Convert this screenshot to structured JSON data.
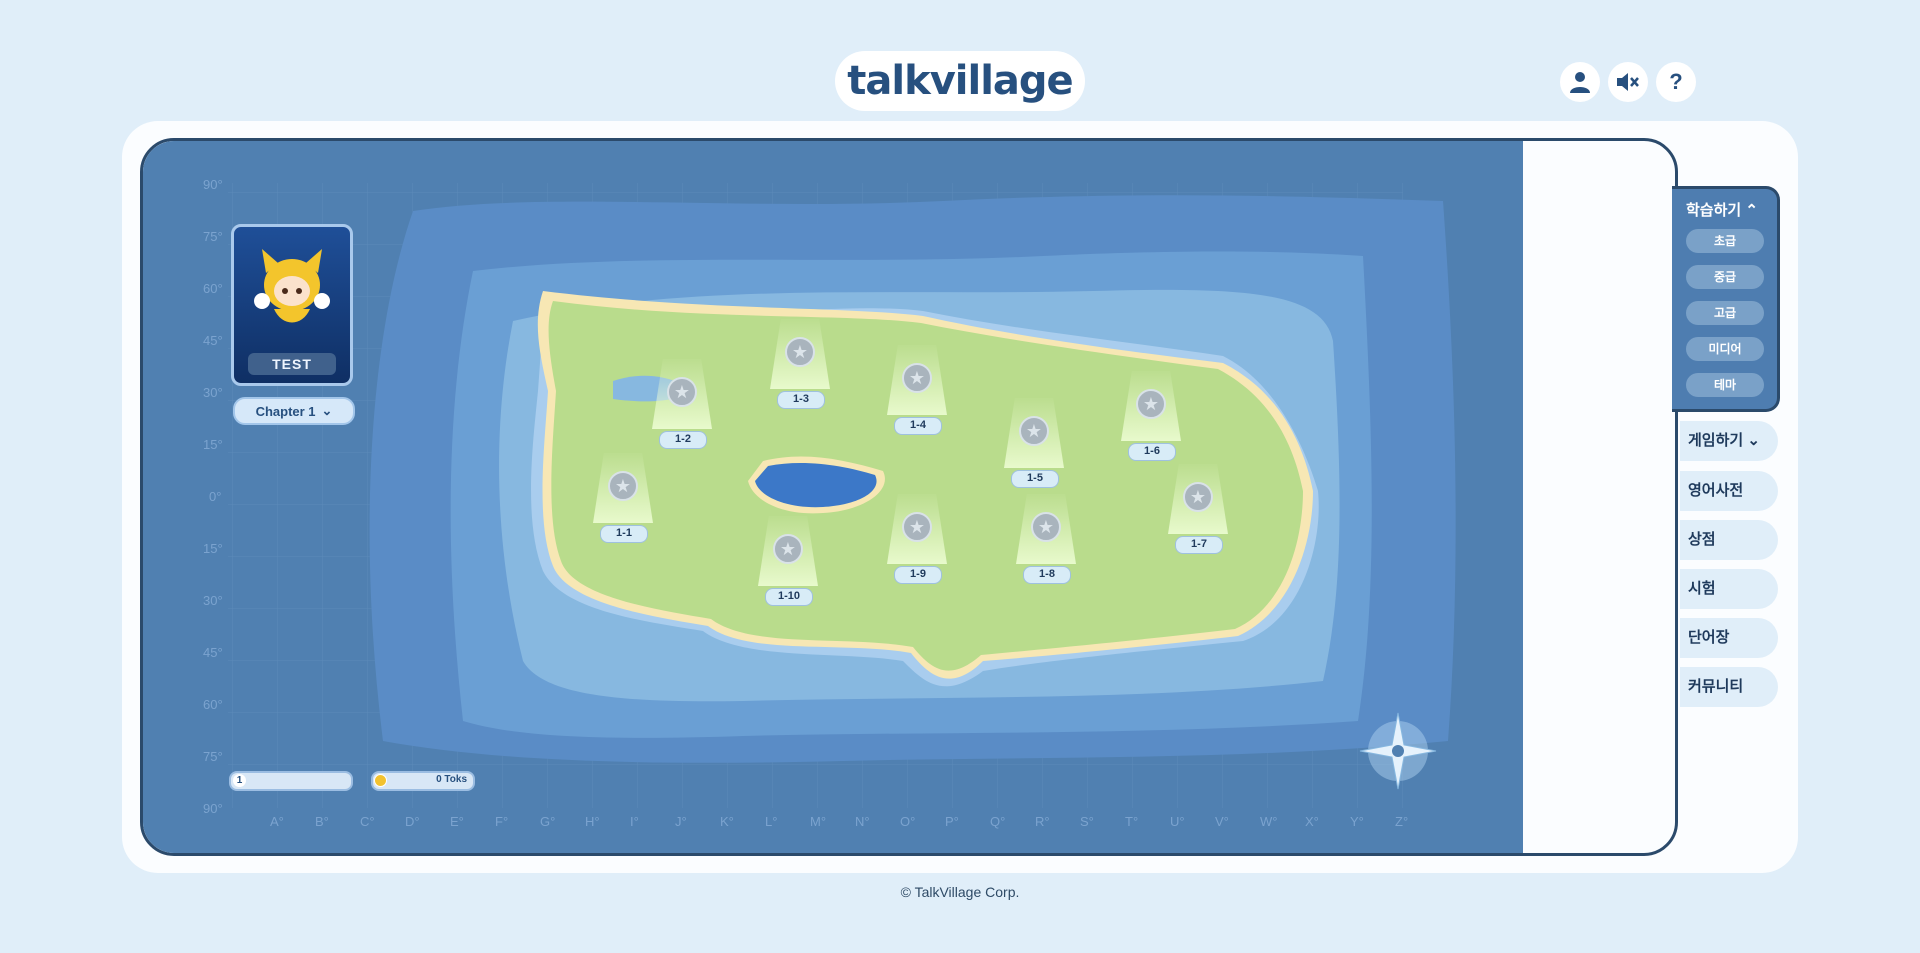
{
  "header": {
    "logo": "talkvillage"
  },
  "top_icons": {
    "help_label": "?"
  },
  "map": {
    "lat_labels": [
      "90°",
      "75°",
      "60°",
      "45°",
      "30°",
      "15°",
      "0°",
      "15°",
      "30°",
      "45°",
      "60°",
      "75°",
      "90°"
    ],
    "lon_labels": [
      "A°",
      "B°",
      "C°",
      "D°",
      "E°",
      "F°",
      "G°",
      "H°",
      "I°",
      "J°",
      "K°",
      "L°",
      "M°",
      "N°",
      "O°",
      "P°",
      "Q°",
      "R°",
      "S°",
      "T°",
      "U°",
      "V°",
      "W°",
      "X°",
      "Y°",
      "Z°"
    ],
    "stages": [
      "1-1",
      "1-2",
      "1-3",
      "1-4",
      "1-5",
      "1-6",
      "1-7",
      "1-8",
      "1-9",
      "1-10"
    ]
  },
  "character": {
    "card_label": "TEST",
    "chapter": "Chapter 1"
  },
  "status": {
    "level": "1",
    "coins": "0 Toks"
  },
  "sidebar": {
    "learn_title": "학습하기",
    "learn_items": [
      "초급",
      "중급",
      "고급",
      "미디어",
      "테마"
    ],
    "game_label": "게임하기",
    "items": [
      "영어사전",
      "상점",
      "시험",
      "단어장",
      "커뮤니티"
    ]
  },
  "footer": {
    "copyright": "© TalkVillage Corp."
  }
}
